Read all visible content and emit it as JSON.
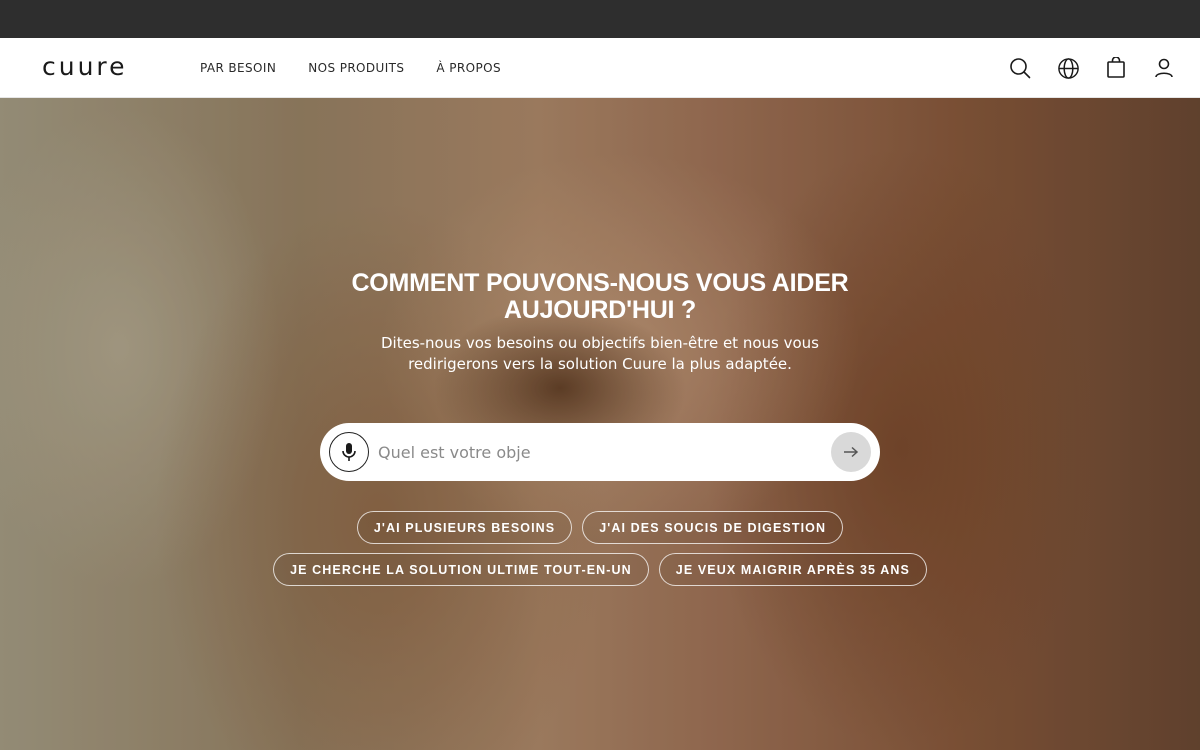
{
  "brand": {
    "logo_text": "cuure"
  },
  "nav": {
    "items": [
      {
        "label": "PAR BESOIN"
      },
      {
        "label": "NOS PRODUITS"
      },
      {
        "label": "À PROPOS"
      }
    ]
  },
  "header_icons": [
    "search-icon",
    "globe-icon",
    "bag-icon",
    "user-icon"
  ],
  "hero": {
    "title_line1": "COMMENT POUVONS-NOUS VOUS AIDER",
    "title_line2": "AUJOURD'HUI ?",
    "subtitle_line1": "Dites-nous vos besoins ou objectifs bien-être et nous vous",
    "subtitle_line2": "redirigerons vers la solution Cuure la plus adaptée.",
    "search": {
      "value": "",
      "placeholder": "Quel est votre obje"
    },
    "suggestions": [
      {
        "label": "J'AI PLUSIEURS BESOINS"
      },
      {
        "label": "J'AI DES SOUCIS DE DIGESTION"
      },
      {
        "label": "JE CHERCHE LA SOLUTION ULTIME TOUT-EN-UN"
      },
      {
        "label": "JE VEUX MAIGRIR APRÈS 35 ANS"
      }
    ]
  },
  "colors": {
    "topbar": "#2e2e2e",
    "header_bg": "#ffffff",
    "text_dark": "#1a1a1a",
    "submit_bg": "#d9d9d9"
  }
}
